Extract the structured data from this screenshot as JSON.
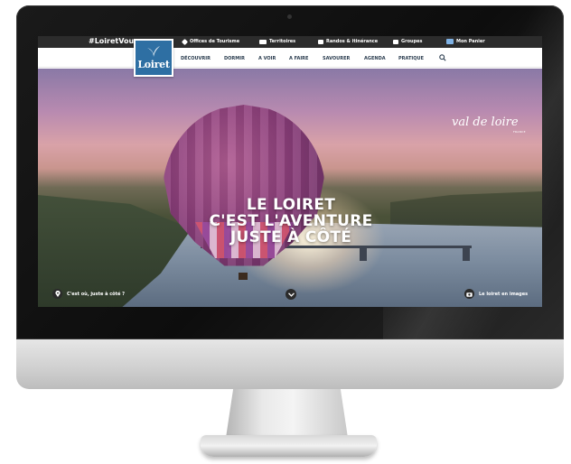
{
  "topbar": {
    "hashtag": "#LoiretVous",
    "links": [
      {
        "label": "Offices de Tourisme",
        "icon": "map-pin-icon"
      },
      {
        "label": "Territoires",
        "icon": "map-icon"
      },
      {
        "label": "Randos & itinérance",
        "icon": "book-icon"
      },
      {
        "label": "Groupes",
        "icon": "users-icon"
      },
      {
        "label": "Mon Panier",
        "icon": "basket-icon"
      }
    ]
  },
  "logo": {
    "text": "Loiret"
  },
  "nav": {
    "items": [
      "DÉCOUVRIR",
      "DORMIR",
      "A VOIR",
      "A FAIRE",
      "SAVOURER",
      "AGENDA",
      "PRATIQUE"
    ]
  },
  "hero": {
    "headline": [
      "LE LOIRET",
      "C'EST L'AVENTURE",
      "JUSTE À CÔTÉ"
    ],
    "brand": "val de loire",
    "brand_sub": "FRANCE",
    "location_link": "C'est où, juste à côté ?",
    "images_link": "Le loiret en images"
  },
  "colors": {
    "topbar_bg": "#2c2c2c",
    "logo_bg": "#2e6fa3",
    "nav_text": "#2c3e50"
  }
}
